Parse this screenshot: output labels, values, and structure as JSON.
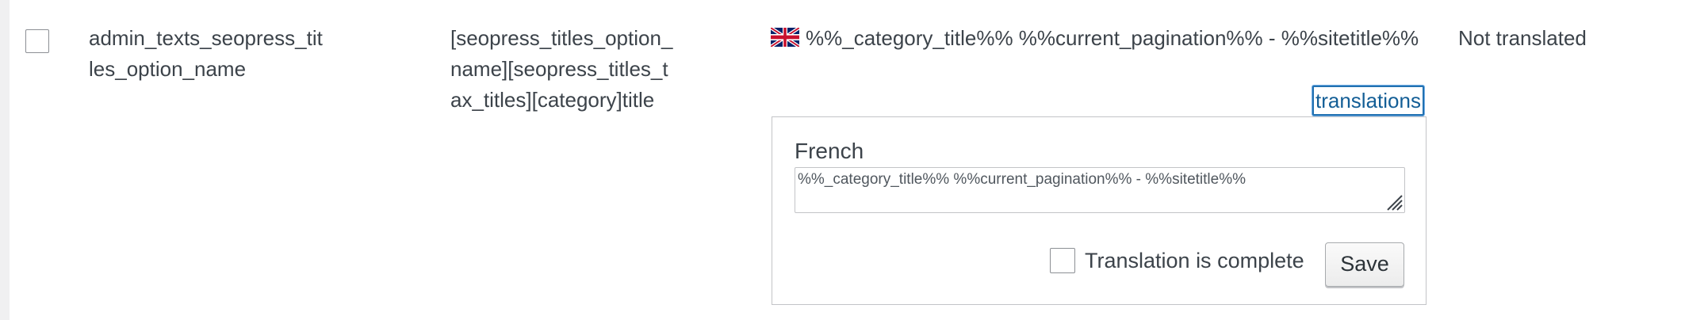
{
  "row": {
    "name": "admin_texts_seopress_titles_option_name",
    "context": "[seopress_titles_option_name][seopress_titles_tax_titles][category]title",
    "original_value": "%%_category_title%% %%current_pagination%% - %%sitetitle%%",
    "status": "Not translated",
    "translations_link": "translations"
  },
  "translation_panel": {
    "language": "French",
    "value": "%%_category_title%% %%current_pagination%% - %%sitetitle%%",
    "complete_label": "Translation is complete",
    "complete_checked": false,
    "save_label": "Save"
  },
  "icons": {
    "flag": "uk-flag-icon",
    "resize": "resize-grip-icon"
  },
  "colors": {
    "link": "#135e96",
    "focus_border": "#2271b1"
  }
}
